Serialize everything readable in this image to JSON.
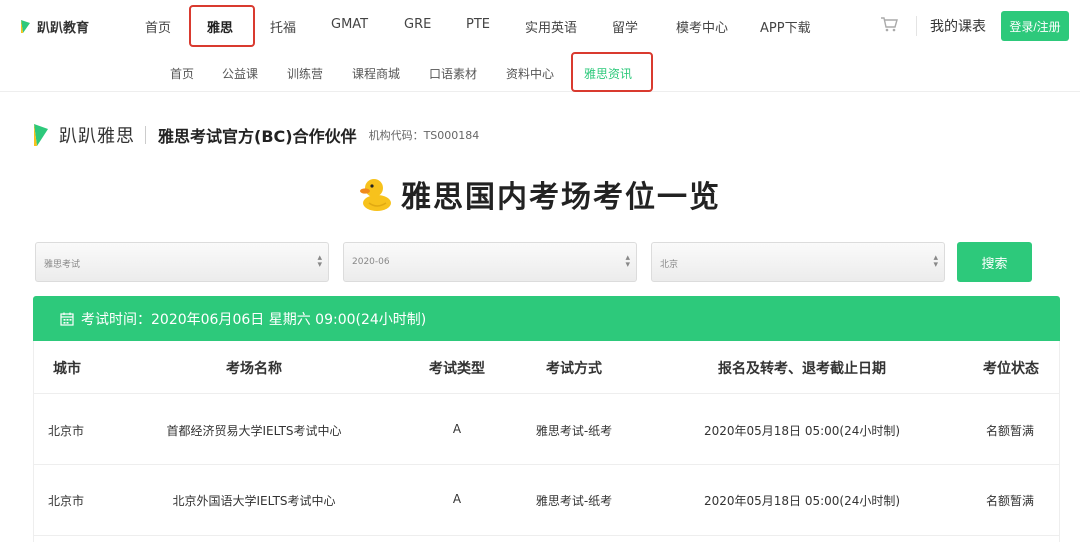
{
  "nav": {
    "logo_text": "趴趴教育",
    "items": [
      "首页",
      "雅思",
      "托福",
      "GMAT",
      "GRE",
      "PTE",
      "实用英语",
      "留学",
      "模考中心",
      "APP下载"
    ],
    "my_course": "我的课表",
    "login": "登录/注册"
  },
  "subnav": {
    "items": [
      "首页",
      "公益课",
      "训练营",
      "课程商城",
      "口语素材",
      "资料中心",
      "雅思资讯"
    ]
  },
  "brand": {
    "name": "趴趴雅思",
    "partner": "雅思考试官方(BC)合作伙伴",
    "code": "机构代码：TS000184"
  },
  "page_title": "雅思国内考场考位一览",
  "filters": {
    "exam": "雅思考试",
    "month": "2020-06",
    "city": "北京",
    "search": "搜索"
  },
  "exam": {
    "time_label": "考试时间：2020年06月06日 星期六 09:00(24小时制)"
  },
  "table": {
    "headers": [
      "城市",
      "考场名称",
      "考试类型",
      "考试方式",
      "报名及转考、退考截止日期",
      "考位状态"
    ],
    "rows": [
      [
        "北京市",
        "首都经济贸易大学IELTS考试中心",
        "A",
        "雅思考试-纸考",
        "2020年05月18日 05:00(24小时制)",
        "名额暂满"
      ],
      [
        "北京市",
        "北京外国语大学IELTS考试中心",
        "A",
        "雅思考试-纸考",
        "2020年05月18日 05:00(24小时制)",
        "名额暂满"
      ]
    ]
  },
  "colors": {
    "accent": "#2dc97b",
    "highlight": "#d93a2f"
  },
  "icons": [
    "logo-leaf-icon",
    "cart-icon",
    "duck-icon",
    "calendar-icon",
    "select-arrows-icon"
  ]
}
